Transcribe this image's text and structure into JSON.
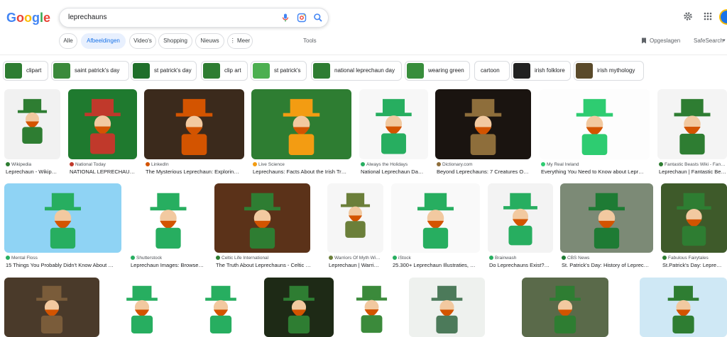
{
  "logo": {
    "letters": [
      "G",
      "o",
      "o",
      "g",
      "l",
      "e"
    ],
    "colors": [
      "#4285F4",
      "#EA4335",
      "#FBBC05",
      "#4285F4",
      "#34A853",
      "#EA4335"
    ]
  },
  "search": {
    "query": "leprechauns"
  },
  "tabs": [
    {
      "label": "Alle",
      "active": false
    },
    {
      "label": "Afbeeldingen",
      "active": true
    },
    {
      "label": "Video's",
      "active": false
    },
    {
      "label": "Shopping",
      "active": false
    },
    {
      "label": "Nieuws",
      "active": false
    },
    {
      "label": "⋮ Meer",
      "active": false
    }
  ],
  "tools_label": "Tools",
  "saved_label": "Opgeslagen",
  "safesearch_label": "SafeSearch",
  "chips": [
    {
      "label": "clipart"
    },
    {
      "label": "saint patrick's day"
    },
    {
      "label": "st patrick's day"
    },
    {
      "label": "clip art"
    },
    {
      "label": "st patrick's"
    },
    {
      "label": "national leprechaun day"
    },
    {
      "label": "wearing green"
    },
    {
      "label": "cartoon"
    },
    {
      "label": "irish folklore"
    },
    {
      "label": "irish mythology"
    }
  ],
  "results": [
    {
      "source": "Wikipedia",
      "title": "Leprechaun - Wikip…",
      "color": "#f1f1f1",
      "accent": "#2e7d32"
    },
    {
      "source": "National Today",
      "title": "NATIONAL LEPRECHAU…",
      "color": "#1f7a2f",
      "accent": "#c0392b"
    },
    {
      "source": "LinkedIn",
      "title": "The Mysterious Leprechaun: Explorin…",
      "color": "#3b2a1c",
      "accent": "#d35400"
    },
    {
      "source": "Live Science",
      "title": "Leprechauns: Facts About the Irish Tr…",
      "color": "#2e7d32",
      "accent": "#f39c12"
    },
    {
      "source": "Always the Holidays",
      "title": "National Leprechaun Da…",
      "color": "#f7f7f7",
      "accent": "#27ae60"
    },
    {
      "source": "Dictionary.com",
      "title": "Beyond Leprechauns: 7 Creatures O…",
      "color": "#1a1410",
      "accent": "#8e6e3b"
    },
    {
      "source": "My Real Ireland",
      "title": "Everything You Need to Know about Lepr…",
      "color": "#fdfdfd",
      "accent": "#2ecc71"
    },
    {
      "source": "Fantastic Beasts Wiki - Fan…",
      "title": "Leprechaun | Fantastic Be…",
      "color": "#f4f4f4",
      "accent": "#2e7d32"
    },
    {
      "source": "Mental Floss",
      "title": "15 Things You Probably Didn't Know About …",
      "color": "#8fd3f4",
      "accent": "#27ae60"
    },
    {
      "source": "Shutterstock",
      "title": "Leprechaun Images: Browse…",
      "color": "#ffffff",
      "accent": "#27ae60"
    },
    {
      "source": "Celtic Life International",
      "title": "The Truth About Leprechauns - Celtic L…",
      "color": "#5b3219",
      "accent": "#2e7d32"
    },
    {
      "source": "Warriors Of Myth Wi…",
      "title": "Leprechaun | Warri…",
      "color": "#f6f6f6",
      "accent": "#6b7f3a"
    },
    {
      "source": "iStock",
      "title": "25.300+ Leprechaun Illustraties, …",
      "color": "#f9f9f9",
      "accent": "#27ae60"
    },
    {
      "source": "Brainwash",
      "title": "Do Leprechauns Exist?…",
      "color": "#f3f3f3",
      "accent": "#27ae60"
    },
    {
      "source": "CBS News",
      "title": "St. Patrick's Day: History of Leprec…",
      "color": "#7c8a76",
      "accent": "#1e7b34"
    },
    {
      "source": "Fabulous Fairytales",
      "title": "St.Patrick's Day: Lepre…",
      "color": "#3e5a2a",
      "accent": "#2e7d32"
    },
    {
      "source": "",
      "title": "",
      "color": "#4a3a2a",
      "accent": "#7a5c3a"
    },
    {
      "source": "",
      "title": "",
      "color": "#ffffff",
      "accent": "#27ae60"
    },
    {
      "source": "",
      "title": "",
      "color": "#ffffff",
      "accent": "#27ae60"
    },
    {
      "source": "",
      "title": "",
      "color": "#1e2a16",
      "accent": "#2e7d32"
    },
    {
      "source": "",
      "title": "",
      "color": "#ffffff",
      "accent": "#3b8a3b"
    },
    {
      "source": "",
      "title": "",
      "color": "#eef1ee",
      "accent": "#4c7a5a"
    },
    {
      "source": "",
      "title": "",
      "color": "#5a6a4a",
      "accent": "#2e7d32"
    },
    {
      "source": "",
      "title": "",
      "color": "#cfe8f5",
      "accent": "#2e7d32"
    }
  ]
}
